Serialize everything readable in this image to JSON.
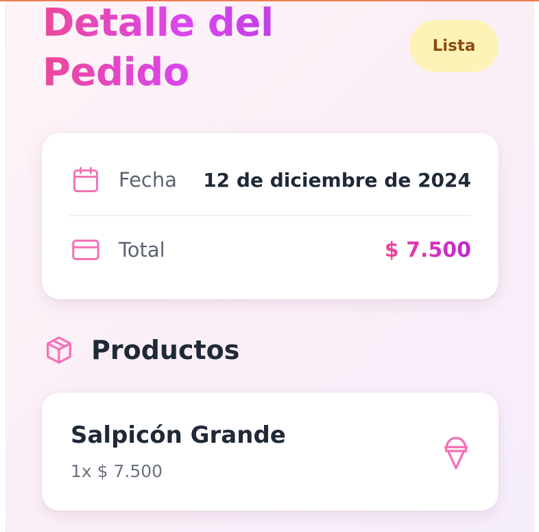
{
  "header": {
    "title": "Detalle del Pedido",
    "status_badge": "Lista"
  },
  "summary": {
    "date_label": "Fecha",
    "date_value": "12 de diciembre de 2024",
    "total_label": "Total",
    "total_value": "$ 7.500"
  },
  "products_section": {
    "title": "Productos",
    "items": [
      {
        "name": "Salpicón Grande",
        "quantity_price": "1x $ 7.500",
        "icon": "ice-cream-icon"
      }
    ]
  },
  "icons": {
    "date": "calendar-icon",
    "total": "credit-card-icon",
    "products": "package-icon"
  },
  "colors": {
    "accent_pink": "#ec4899",
    "accent_purple": "#c026d3",
    "badge_background": "#fdf3b7",
    "badge_text": "#8a4b12"
  }
}
